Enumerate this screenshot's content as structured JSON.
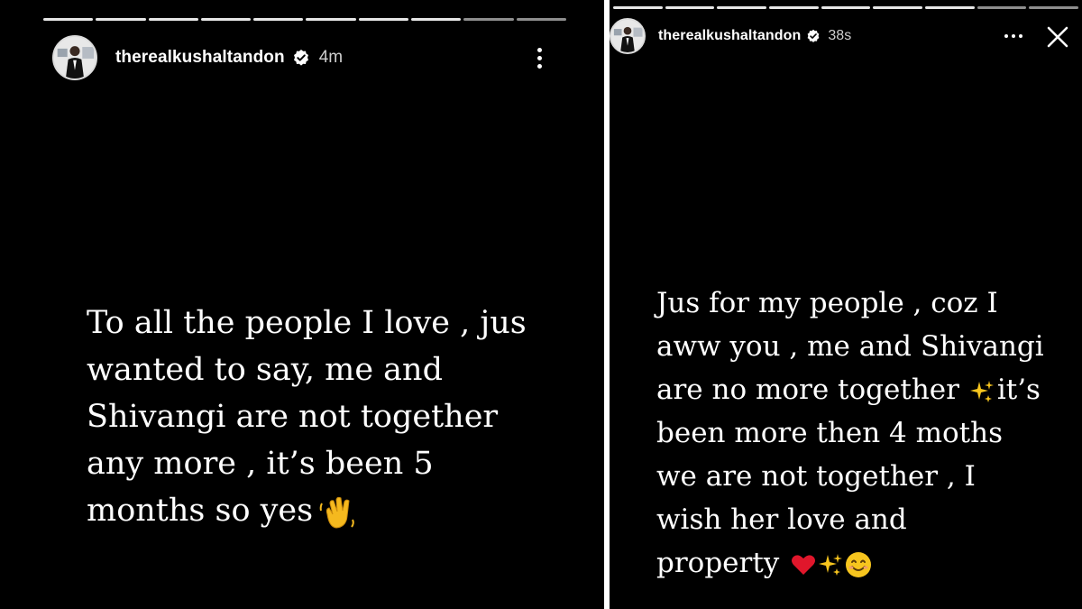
{
  "left_story": {
    "username": "therealkushaltandon",
    "time": "4m",
    "caption": "To all the people I love , jus\nwanted to say, me and\nShivangi are not together\nany more , it’s been 5\nmonths so yes",
    "caption_emoji": "waving-hand",
    "progress_segments": 10,
    "icons": [
      "avatar",
      "verified-badge-icon",
      "more-vertical-icon"
    ]
  },
  "right_story": {
    "username": "therealkushaltandon",
    "time": "38s",
    "caption_line1": "Jus for my people , coz I\naww you , me and Shivangi\nare no more together ",
    "caption_line2": "it’s\nbeen more then 4 moths\nwe are not together , I\nwish her love and\nproperty ",
    "emojis": [
      "sparkles",
      "red-heart",
      "sparkles",
      "smiling-face"
    ],
    "progress_segments": 9,
    "icons": [
      "avatar",
      "verified-badge-icon",
      "more-horizontal-icon",
      "close-icon"
    ]
  },
  "colors": {
    "background": "#000000",
    "text": "#ffffff",
    "heart": "#e0162b",
    "sparkle": "#f7c51e"
  }
}
